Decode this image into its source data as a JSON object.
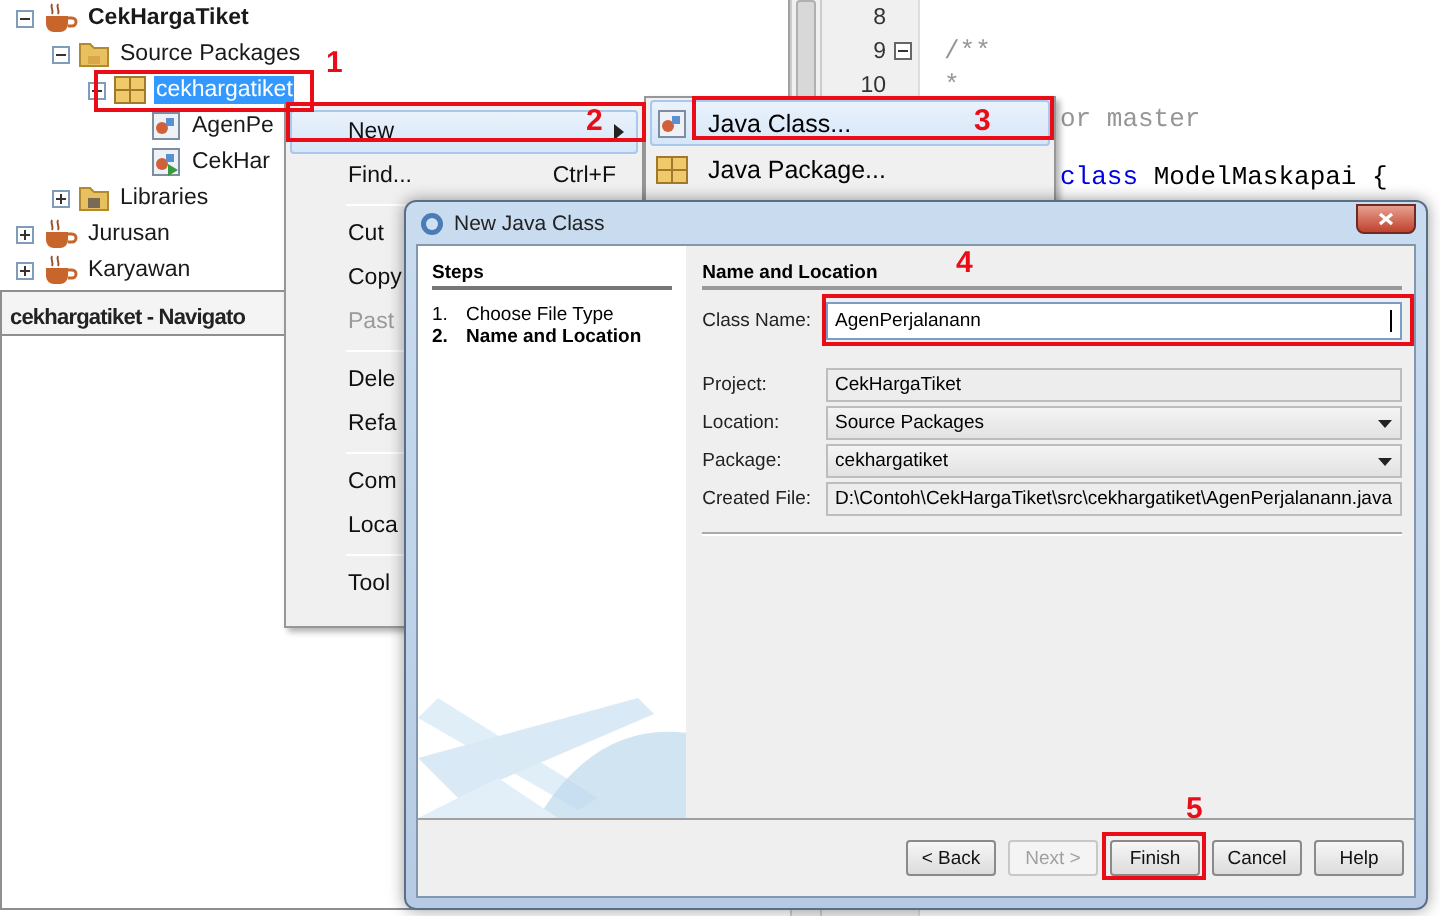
{
  "project_tree": [
    {
      "label": "CekHargaTiket",
      "kind": "project",
      "expanded": true,
      "selected": false,
      "children": [
        {
          "label": "Source Packages",
          "kind": "folder",
          "expanded": true,
          "selected": false,
          "children": [
            {
              "label": "cekhargatiket",
              "kind": "package",
              "expanded": true,
              "selected": true,
              "children": [
                {
                  "label": "AgenPe",
                  "kind": "class",
                  "selected": false
                },
                {
                  "label": "CekHar",
                  "kind": "main-class",
                  "selected": false
                }
              ]
            }
          ]
        },
        {
          "label": "Libraries",
          "kind": "library",
          "expanded": false,
          "selected": false
        }
      ]
    },
    {
      "label": "Jurusan",
      "kind": "project",
      "expanded": false,
      "selected": false
    },
    {
      "label": "Karyawan",
      "kind": "project",
      "expanded": false,
      "selected": false
    }
  ],
  "navigator": {
    "title": "cekhargatiket - Navigato"
  },
  "editor": {
    "lines": [
      {
        "kind": "numbered",
        "number": "8",
        "fold": false
      },
      {
        "kind": "numbered",
        "number": "9",
        "fold": true,
        "tokens": [
          {
            "kind": "comment",
            "text": "/**"
          }
        ]
      },
      {
        "kind": "numbered",
        "number": "10",
        "fold": false,
        "tokens": [
          {
            "kind": "comment",
            "text": "*"
          }
        ]
      },
      {
        "kind": "covered",
        "tokens": [
          {
            "kind": "comment",
            "text": "or master"
          }
        ]
      },
      {
        "kind": "covered",
        "tokens": [
          {
            "kind": "keyword",
            "text": "class"
          },
          {
            "kind": "plain",
            "text": " ModelMaskapai {"
          }
        ]
      }
    ]
  },
  "context_menu": [
    {
      "kind": "item",
      "label": "New",
      "selected": true,
      "disabled": false,
      "has_submenu": true
    },
    {
      "kind": "item",
      "label": "Find...",
      "shortcut": "Ctrl+F",
      "selected": false,
      "disabled": false,
      "has_submenu": false
    },
    {
      "kind": "separator"
    },
    {
      "kind": "item",
      "label": "Cut",
      "selected": false,
      "disabled": false,
      "has_submenu": false
    },
    {
      "kind": "item",
      "label": "Copy",
      "selected": false,
      "disabled": false,
      "has_submenu": false
    },
    {
      "kind": "item",
      "label": "Past",
      "selected": false,
      "disabled": true,
      "has_submenu": false
    },
    {
      "kind": "separator"
    },
    {
      "kind": "item",
      "label": "Dele",
      "selected": false,
      "disabled": false,
      "has_submenu": false
    },
    {
      "kind": "item",
      "label": "Refa",
      "selected": false,
      "disabled": false,
      "has_submenu": false
    },
    {
      "kind": "separator"
    },
    {
      "kind": "item",
      "label": "Com",
      "selected": false,
      "disabled": false,
      "has_submenu": false
    },
    {
      "kind": "item",
      "label": "Loca",
      "selected": false,
      "disabled": false,
      "has_submenu": false
    },
    {
      "kind": "separator"
    },
    {
      "kind": "item",
      "label": "Tool",
      "selected": false,
      "disabled": false,
      "has_submenu": false
    }
  ],
  "submenu": [
    {
      "label": "Java Class...",
      "kind": "class",
      "selected": true
    },
    {
      "label": "Java Package...",
      "kind": "package",
      "selected": false
    }
  ],
  "dialog": {
    "title": "New Java Class",
    "steps_title": "Steps",
    "steps": [
      {
        "number": "1.",
        "label": "Choose File Type",
        "selected": false
      },
      {
        "number": "2.",
        "label": "Name and Location",
        "selected": true
      }
    ],
    "heading": "Name and Location",
    "fields": [
      {
        "label": "Class Name:",
        "value": "AgenPerjalanann",
        "kind": "text"
      },
      {
        "label": "Project:",
        "value": "CekHargaTiket",
        "kind": "readonly"
      },
      {
        "label": "Location:",
        "value": "Source Packages",
        "kind": "combo"
      },
      {
        "label": "Package:",
        "value": "cekhargatiket",
        "kind": "combo"
      },
      {
        "label": "Created File:",
        "value": "D:\\Contoh\\CekHargaTiket\\src\\cekhargatiket\\AgenPerjalanann.java",
        "kind": "readonly"
      }
    ],
    "buttons": [
      {
        "label": "< Back",
        "disabled": false
      },
      {
        "label": "Next >",
        "disabled": true
      },
      {
        "label": "Finish",
        "disabled": false
      },
      {
        "label": "Cancel",
        "disabled": false
      },
      {
        "label": "Help",
        "disabled": false
      }
    ]
  },
  "annotations": [
    {
      "label": "1"
    },
    {
      "label": "2"
    },
    {
      "label": "3"
    },
    {
      "label": "4"
    },
    {
      "label": "5"
    }
  ]
}
